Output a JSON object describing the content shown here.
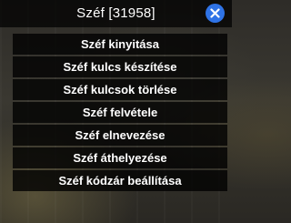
{
  "window": {
    "title": "Széf [31958]"
  },
  "menu": {
    "items": [
      {
        "label": "Széf kinyitása"
      },
      {
        "label": "Széf kulcs készítése"
      },
      {
        "label": "Széf kulcsok törlése"
      },
      {
        "label": "Széf felvétele"
      },
      {
        "label": "Széf elnevezése"
      },
      {
        "label": "Széf áthelyezése"
      },
      {
        "label": "Széf kódzár beállítása"
      }
    ]
  },
  "icons": {
    "close": "close-icon"
  },
  "colors": {
    "close_button": "#2f73e6",
    "item_background": "#000000",
    "text": "#ffffff"
  }
}
